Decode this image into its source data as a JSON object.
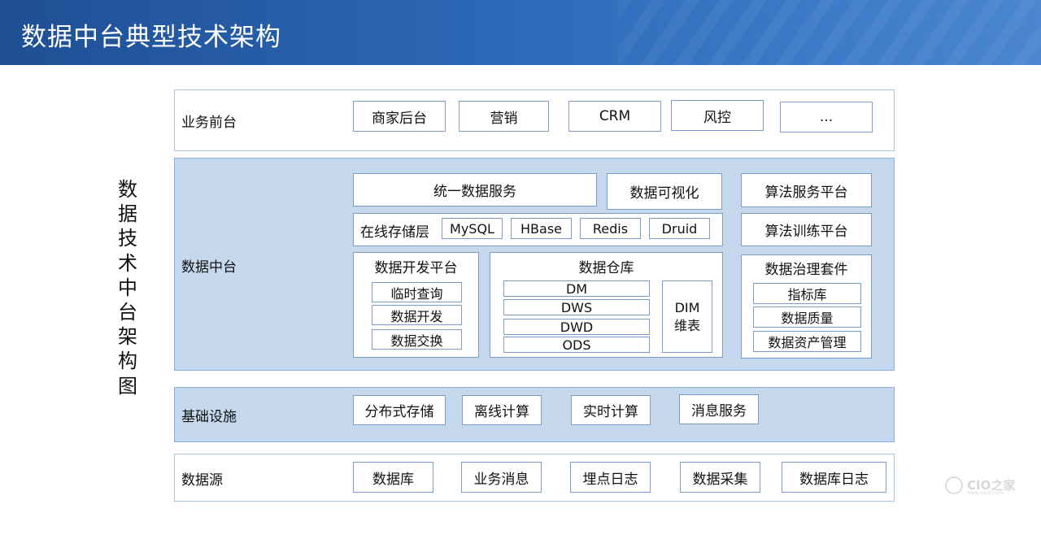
{
  "title": "数据中台典型技术架构",
  "side_title": "数据技术中台架构图",
  "layers": {
    "front": {
      "label": "业务前台",
      "items": [
        "商家后台",
        "营销",
        "CRM",
        "风控",
        "..."
      ]
    },
    "middle": {
      "label": "数据中台",
      "unified_service": "统一数据服务",
      "visualization": "数据可视化",
      "algo_service": "算法服务平台",
      "algo_training": "算法训练平台",
      "online_storage": {
        "label": "在线存储层",
        "items": [
          "MySQL",
          "HBase",
          "Redis",
          "Druid"
        ]
      },
      "dev_platform": {
        "title": "数据开发平台",
        "items": [
          "临时查询",
          "数据开发",
          "数据交换"
        ]
      },
      "warehouse": {
        "title": "数据仓库",
        "layers": [
          "DM",
          "DWS",
          "DWD",
          "ODS"
        ],
        "dim": "DIM\n维表"
      },
      "governance": {
        "title": "数据治理套件",
        "items": [
          "指标库",
          "数据质量",
          "数据资产管理"
        ]
      }
    },
    "infra": {
      "label": "基础设施",
      "items": [
        "分布式存储",
        "离线计算",
        "实时计算",
        "消息服务"
      ]
    },
    "source": {
      "label": "数据源",
      "items": [
        "数据库",
        "业务消息",
        "埋点日志",
        "数据采集",
        "数据库日志"
      ]
    }
  },
  "watermark": {
    "text": "CIO之家",
    "sub": "www.ciozj.com"
  },
  "colors": {
    "header": "#2c67b5",
    "layer_fill": "#c5d8ee",
    "box_border": "#7a9cc6"
  }
}
